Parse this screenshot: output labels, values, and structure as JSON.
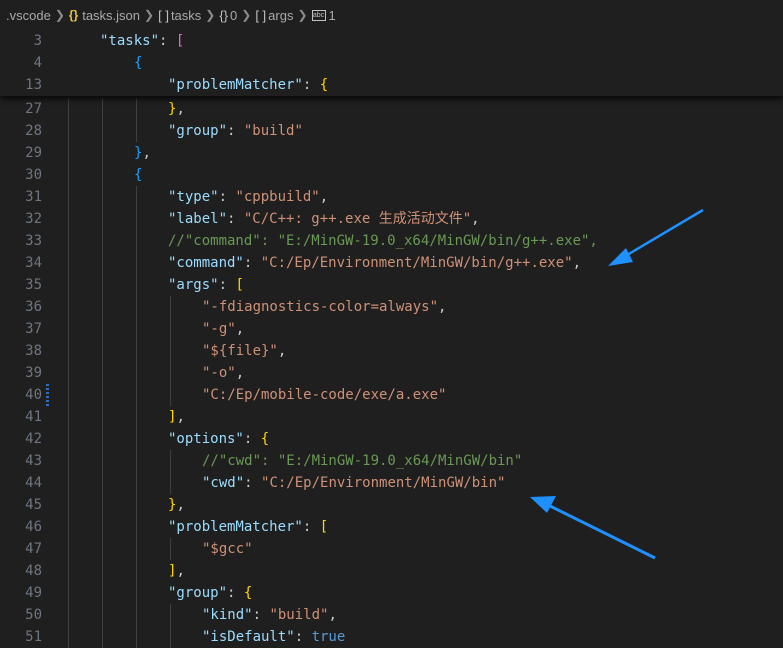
{
  "breadcrumb": {
    "folder": ".vscode",
    "file": "tasks.json",
    "tasks": "tasks",
    "index": "0",
    "args": "args",
    "item": "1"
  },
  "sticky": [
    {
      "n": "3",
      "indent": 1,
      "tokens": [
        {
          "t": "k",
          "v": "\"tasks\""
        },
        {
          "t": "p",
          "v": ": "
        },
        {
          "t": "b1",
          "v": "["
        }
      ]
    },
    {
      "n": "4",
      "indent": 2,
      "tokens": [
        {
          "t": "b2",
          "v": "{"
        }
      ]
    },
    {
      "n": "13",
      "indent": 3,
      "tokens": [
        {
          "t": "k",
          "v": "\"problemMatcher\""
        },
        {
          "t": "p",
          "v": ": "
        },
        {
          "t": "b3",
          "v": "{"
        }
      ]
    }
  ],
  "lines": [
    {
      "n": "27",
      "indent": 3,
      "tokens": [
        {
          "t": "b3",
          "v": "}"
        },
        {
          "t": "p",
          "v": ","
        }
      ]
    },
    {
      "n": "28",
      "indent": 3,
      "tokens": [
        {
          "t": "k",
          "v": "\"group\""
        },
        {
          "t": "p",
          "v": ": "
        },
        {
          "t": "s",
          "v": "\"build\""
        }
      ]
    },
    {
      "n": "29",
      "indent": 2,
      "tokens": [
        {
          "t": "b2",
          "v": "}"
        },
        {
          "t": "p",
          "v": ","
        }
      ]
    },
    {
      "n": "30",
      "indent": 2,
      "tokens": [
        {
          "t": "b2",
          "v": "{"
        }
      ]
    },
    {
      "n": "31",
      "indent": 3,
      "tokens": [
        {
          "t": "k",
          "v": "\"type\""
        },
        {
          "t": "p",
          "v": ": "
        },
        {
          "t": "s",
          "v": "\"cppbuild\""
        },
        {
          "t": "p",
          "v": ","
        }
      ]
    },
    {
      "n": "32",
      "indent": 3,
      "tokens": [
        {
          "t": "k",
          "v": "\"label\""
        },
        {
          "t": "p",
          "v": ": "
        },
        {
          "t": "s",
          "v": "\"C/C++: g++.exe 生成活动文件\""
        },
        {
          "t": "p",
          "v": ","
        }
      ]
    },
    {
      "n": "33",
      "indent": 3,
      "tokens": [
        {
          "t": "c",
          "v": "//\"command\": \"E:/MinGW-19.0_x64/MinGW/bin/g++.exe\","
        }
      ]
    },
    {
      "n": "34",
      "indent": 3,
      "tokens": [
        {
          "t": "k",
          "v": "\"command\""
        },
        {
          "t": "p",
          "v": ": "
        },
        {
          "t": "s",
          "v": "\"C:/Ep/Environment/MinGW/bin/g++.exe\""
        },
        {
          "t": "p",
          "v": ","
        }
      ]
    },
    {
      "n": "35",
      "indent": 3,
      "tokens": [
        {
          "t": "k",
          "v": "\"args\""
        },
        {
          "t": "p",
          "v": ": "
        },
        {
          "t": "b3",
          "v": "["
        }
      ]
    },
    {
      "n": "36",
      "indent": 4,
      "tokens": [
        {
          "t": "s",
          "v": "\"-fdiagnostics-color=always\""
        },
        {
          "t": "p",
          "v": ","
        }
      ]
    },
    {
      "n": "37",
      "indent": 4,
      "tokens": [
        {
          "t": "s",
          "v": "\"-g\""
        },
        {
          "t": "p",
          "v": ","
        }
      ]
    },
    {
      "n": "38",
      "indent": 4,
      "tokens": [
        {
          "t": "s",
          "v": "\"${file}\""
        },
        {
          "t": "p",
          "v": ","
        }
      ]
    },
    {
      "n": "39",
      "indent": 4,
      "tokens": [
        {
          "t": "s",
          "v": "\"-o\""
        },
        {
          "t": "p",
          "v": ","
        }
      ]
    },
    {
      "n": "40",
      "indent": 4,
      "tokens": [
        {
          "t": "s",
          "v": "\"C:/Ep/mobile-code/exe/a.exe\""
        }
      ]
    },
    {
      "n": "41",
      "indent": 3,
      "tokens": [
        {
          "t": "b3",
          "v": "]"
        },
        {
          "t": "p",
          "v": ","
        }
      ]
    },
    {
      "n": "42",
      "indent": 3,
      "tokens": [
        {
          "t": "k",
          "v": "\"options\""
        },
        {
          "t": "p",
          "v": ": "
        },
        {
          "t": "b3",
          "v": "{"
        }
      ]
    },
    {
      "n": "43",
      "indent": 4,
      "tokens": [
        {
          "t": "c",
          "v": "//\"cwd\": \"E:/MinGW-19.0_x64/MinGW/bin\""
        }
      ]
    },
    {
      "n": "44",
      "indent": 4,
      "tokens": [
        {
          "t": "k",
          "v": "\"cwd\""
        },
        {
          "t": "p",
          "v": ": "
        },
        {
          "t": "s",
          "v": "\"C:/Ep/Environment/MinGW/bin\""
        }
      ]
    },
    {
      "n": "45",
      "indent": 3,
      "tokens": [
        {
          "t": "b3",
          "v": "}"
        },
        {
          "t": "p",
          "v": ","
        }
      ]
    },
    {
      "n": "46",
      "indent": 3,
      "tokens": [
        {
          "t": "k",
          "v": "\"problemMatcher\""
        },
        {
          "t": "p",
          "v": ": "
        },
        {
          "t": "b3",
          "v": "["
        }
      ]
    },
    {
      "n": "47",
      "indent": 4,
      "tokens": [
        {
          "t": "s",
          "v": "\"$gcc\""
        }
      ]
    },
    {
      "n": "48",
      "indent": 3,
      "tokens": [
        {
          "t": "b3",
          "v": "]"
        },
        {
          "t": "p",
          "v": ","
        }
      ]
    },
    {
      "n": "49",
      "indent": 3,
      "tokens": [
        {
          "t": "k",
          "v": "\"group\""
        },
        {
          "t": "p",
          "v": ": "
        },
        {
          "t": "b3",
          "v": "{"
        }
      ]
    },
    {
      "n": "50",
      "indent": 4,
      "tokens": [
        {
          "t": "k",
          "v": "\"kind\""
        },
        {
          "t": "p",
          "v": ": "
        },
        {
          "t": "s",
          "v": "\"build\""
        },
        {
          "t": "p",
          "v": ","
        }
      ]
    },
    {
      "n": "51",
      "indent": 4,
      "tokens": [
        {
          "t": "k",
          "v": "\"isDefault\""
        },
        {
          "t": "p",
          "v": ": "
        },
        {
          "t": "kw",
          "v": "true"
        }
      ]
    }
  ],
  "modified_line": "40",
  "colors": {
    "background": "#1f1f1f",
    "key": "#9cdcfe",
    "string": "#ce9178",
    "comment": "#6a9955",
    "arrow": "#1e90ff"
  }
}
